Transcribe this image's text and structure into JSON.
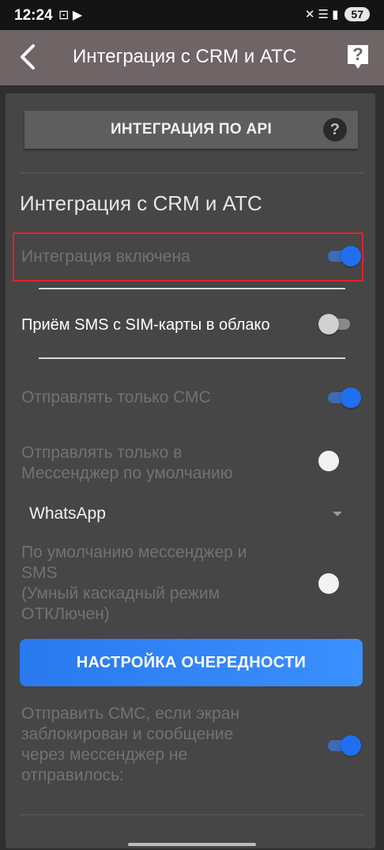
{
  "status_bar": {
    "time": "12:24",
    "left_icons": "⊡ ▶",
    "right_icons": "✕ ☰ ▮",
    "battery": "57"
  },
  "app_bar": {
    "title": "Интеграция с CRM и АТС",
    "help_label": "?"
  },
  "api_button": {
    "label": "ИНТЕГРАЦИЯ ПО API",
    "help_label": "?"
  },
  "section": {
    "title": "Интеграция с CRM и АТС"
  },
  "settings": {
    "integration_enabled": {
      "label": "Интеграция включена",
      "on": true
    },
    "sms_cloud": {
      "label": "Приём SMS с SIM-карты в облако",
      "on": false
    },
    "only_sms": {
      "label": "Отправлять только СМС",
      "on": true
    },
    "only_messenger": {
      "label_line1": "Отправлять только в",
      "label_line2": "Мессенджер по умолчанию"
    },
    "messenger_select": {
      "value": "WhatsApp"
    },
    "default_messenger_sms": {
      "line1": "По умолчанию мессенджер и",
      "line2": "SMS",
      "line3": "(Умный каскадный режим",
      "line4": "ОТКЛючен)"
    },
    "queue_button": {
      "label": "НАСТРОЙКА ОЧЕРЕДНОСТИ"
    },
    "send_sms_locked": {
      "line1": "Отправить СМС, если экран",
      "line2": "заблокирован и сообщение",
      "line3": "через мессенджер не",
      "line4": "отправилось:",
      "on": true
    }
  },
  "colors": {
    "accent": "#1f6ff0",
    "highlight": "#e0242a",
    "app_bar": "#6f6466"
  }
}
